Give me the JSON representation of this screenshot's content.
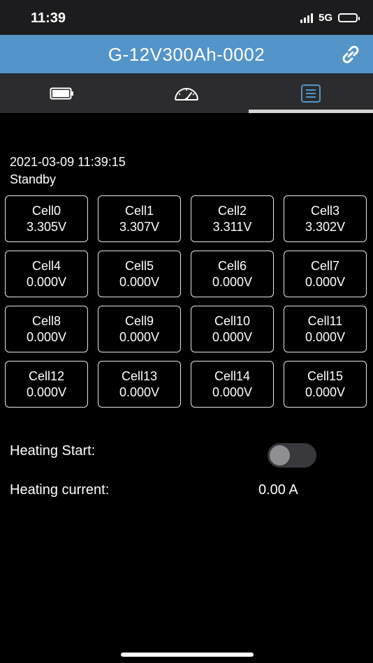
{
  "status_bar": {
    "time": "11:39",
    "network": "5G"
  },
  "header": {
    "title": "G-12V300Ah-0002"
  },
  "tabs": [
    {
      "icon": "battery-icon"
    },
    {
      "icon": "gauge-icon"
    },
    {
      "icon": "list-icon",
      "active": true
    }
  ],
  "info": {
    "timestamp": "2021-03-09 11:39:15",
    "state": "Standby"
  },
  "cells": [
    {
      "name": "Cell0",
      "voltage": "3.305V"
    },
    {
      "name": "Cell1",
      "voltage": "3.307V"
    },
    {
      "name": "Cell2",
      "voltage": "3.311V"
    },
    {
      "name": "Cell3",
      "voltage": "3.302V"
    },
    {
      "name": "Cell4",
      "voltage": "0.000V"
    },
    {
      "name": "Cell5",
      "voltage": "0.000V"
    },
    {
      "name": "Cell6",
      "voltage": "0.000V"
    },
    {
      "name": "Cell7",
      "voltage": "0.000V"
    },
    {
      "name": "Cell8",
      "voltage": "0.000V"
    },
    {
      "name": "Cell9",
      "voltage": "0.000V"
    },
    {
      "name": "Cell10",
      "voltage": "0.000V"
    },
    {
      "name": "Cell11",
      "voltage": "0.000V"
    },
    {
      "name": "Cell12",
      "voltage": "0.000V"
    },
    {
      "name": "Cell13",
      "voltage": "0.000V"
    },
    {
      "name": "Cell14",
      "voltage": "0.000V"
    },
    {
      "name": "Cell15",
      "voltage": "0.000V"
    }
  ],
  "heating": {
    "start_label": "Heating Start:",
    "start_enabled": false,
    "current_label": "Heating current:",
    "current_value": "0.00 A"
  },
  "colors": {
    "header_bg": "#5394c9",
    "active_tab_icon": "#5394c9",
    "tab_bar_bg": "#2c2c2e"
  }
}
